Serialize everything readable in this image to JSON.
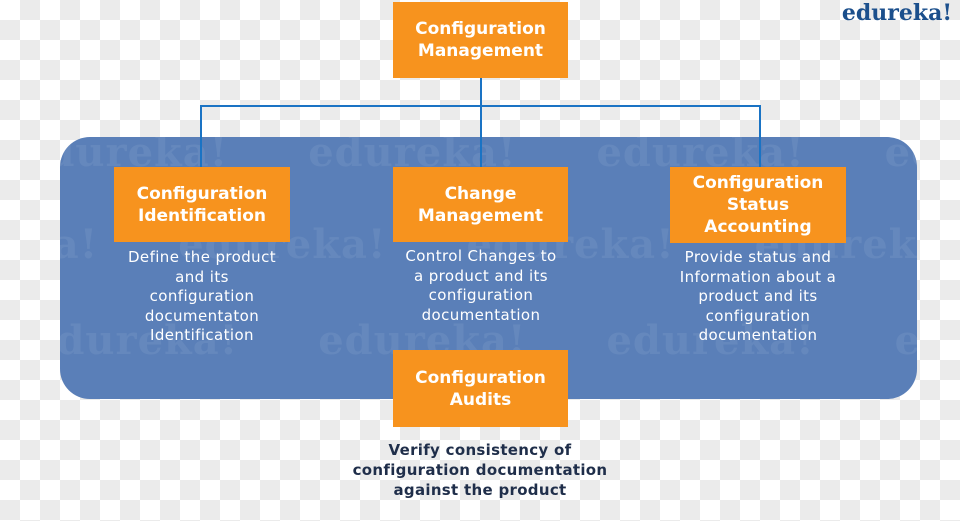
{
  "brand": {
    "logo_text": "edureka!",
    "watermark_text": "edureka!"
  },
  "colors": {
    "box_fill": "#f7931e",
    "panel_fill": "#5a7fb8",
    "connector": "#1a73c4",
    "box_text": "#ffffff",
    "footer_text": "#1f2e4a",
    "logo": "#1b4f8c"
  },
  "root": {
    "title_lines": [
      "Configuration",
      "Management"
    ]
  },
  "children": [
    {
      "title_lines": [
        "Configuration",
        "Identification"
      ],
      "description_lines": [
        "Define the product",
        "and its",
        "configuration",
        "documentaton",
        "Identification"
      ]
    },
    {
      "title_lines": [
        "Change",
        "Management"
      ],
      "description_lines": [
        "Control Changes to",
        "a product and its",
        "configuration",
        "documentation"
      ]
    },
    {
      "title_lines": [
        "Configuration",
        "Status",
        "Accounting"
      ],
      "description_lines": [
        "Provide status and",
        "Information about a",
        "product and its",
        "configuration",
        "documentation"
      ]
    }
  ],
  "audits": {
    "title_lines": [
      "Configuration",
      "Audits"
    ],
    "description_lines": [
      "Verify consistency of",
      "configuration documentation",
      "against the product"
    ]
  }
}
